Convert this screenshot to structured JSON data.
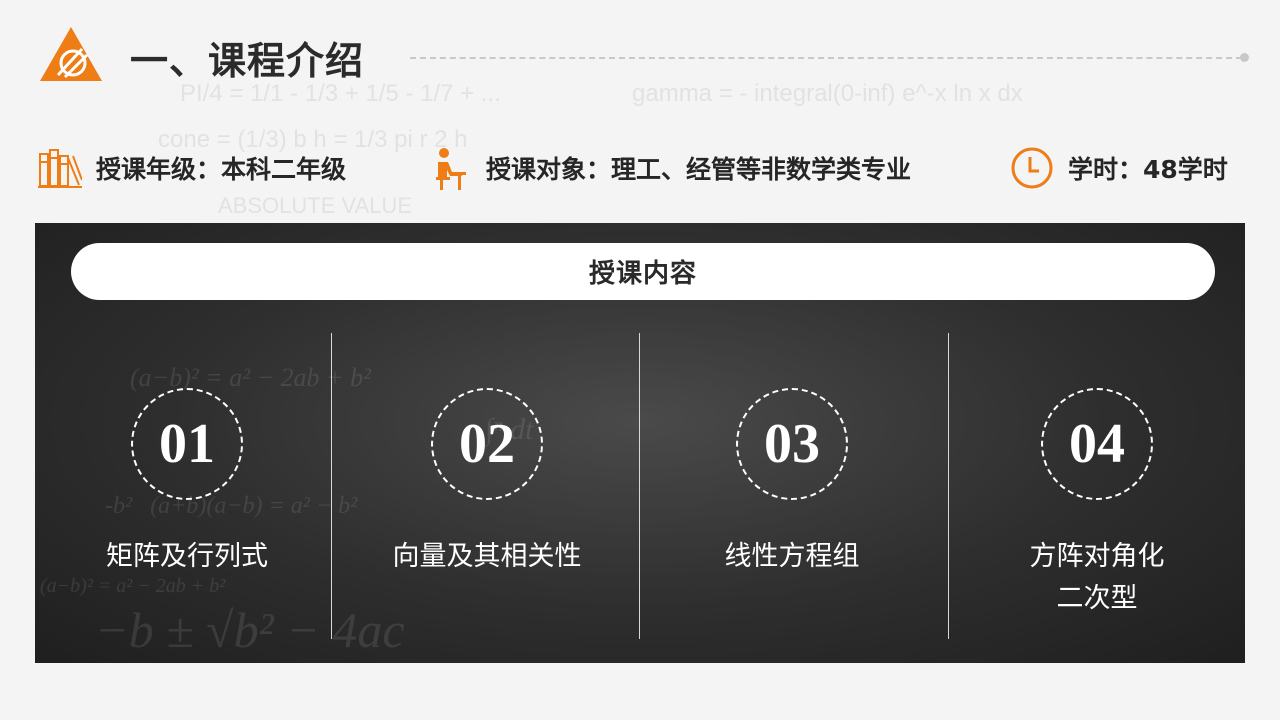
{
  "header": {
    "title": "一、课程介绍"
  },
  "background_formulas": [
    "PI/4 = 1/1 - 1/3 + 1/5 - 1/7 + ...",
    "gamma = - integral(0-inf) e^-x ln x dx",
    "cone = (1/3) b h = 1/3 pi r 2 h",
    "ABSOLUTE VALUE"
  ],
  "info": {
    "grade": "授课年级：本科二年级",
    "target": "授课对象：理工、经管等非数学类专业",
    "hours": "学时：48学时"
  },
  "panel": {
    "heading": "授课内容",
    "topics": [
      {
        "num": "01",
        "label": "矩阵及行列式"
      },
      {
        "num": "02",
        "label": "向量及其相关性"
      },
      {
        "num": "03",
        "label": "线性方程组"
      },
      {
        "num": "04",
        "label": "方阵对角化 二次型"
      }
    ]
  },
  "colors": {
    "accent": "#ee7d16",
    "panel_bg": "#2e2e2e",
    "text_dark": "#262626"
  }
}
